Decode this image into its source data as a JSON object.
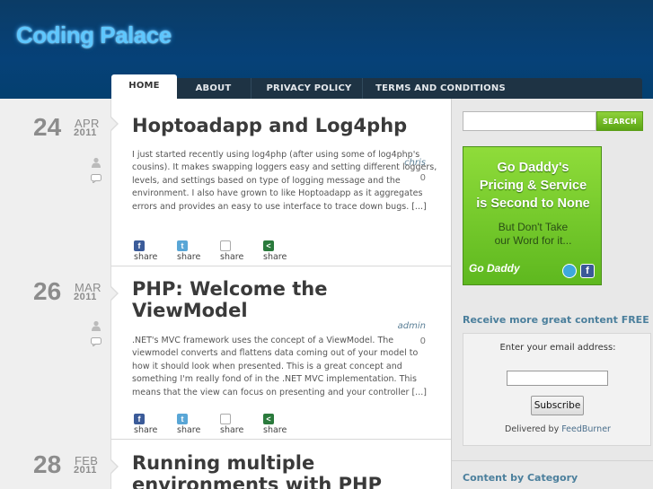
{
  "site": {
    "title": "Coding Palace"
  },
  "nav": {
    "items": [
      "HOME",
      "ABOUT",
      "PRIVACY POLICY",
      "TERMS AND CONDITIONS"
    ],
    "active": "HOME"
  },
  "posts": [
    {
      "day": "24",
      "month": "APR",
      "year": "2011",
      "author": "chris",
      "comments": "0",
      "title": "Hoptoadapp and Log4php",
      "excerpt": "I just started recently using log4php (after using some of log4php's cousins). It makes swapping loggers easy and setting different loggers, levels, and settings based on type of logging message and the environment. I also have grown to like Hoptoadapp as it aggregates errors and provides an easy to use interface to trace down bugs. [...]",
      "share_labels": [
        "share",
        "share",
        "share",
        "share"
      ]
    },
    {
      "day": "26",
      "month": "MAR",
      "year": "2011",
      "author": "admin",
      "comments": "0",
      "title": "PHP: Welcome the ViewModel",
      "excerpt": ".NET's MVC framework uses the concept of a ViewModel. The viewmodel converts and flattens data coming out of your model to how it should look when presented. This is a great concept and something I'm really fond of in the .NET MVC implementation. This means that the view can focus on presenting and your controller [...]",
      "share_labels": [
        "share",
        "share",
        "share",
        "share"
      ]
    },
    {
      "day": "28",
      "month": "FEB",
      "year": "2011",
      "title": "Running multiple environments with PHP"
    }
  ],
  "sidebar": {
    "search_button": "SEARCH",
    "ad": {
      "line1": "Go Daddy's",
      "line2": "Pricing & Service",
      "line3": "is Second to None",
      "line4": "But Don't Take",
      "line5": "our Word for it...",
      "brand": "Go Daddy",
      "fb_glyph": "f"
    },
    "feedburner": {
      "heading": "Receive more great content FREE",
      "label": "Enter your email address:",
      "subscribe": "Subscribe",
      "delivered": "Delivered by",
      "delivered_link": "FeedBurner"
    },
    "category_heading": "Content by Category"
  },
  "colors": {
    "header": "#0b3c66",
    "nav": "#1e3344",
    "accent": "#4b7f9c",
    "search": "#6fbe22"
  },
  "icons": {
    "share": [
      "facebook-icon",
      "twitter-icon",
      "email-icon",
      "share-icon"
    ],
    "meta": [
      "user-icon",
      "comment-bubble-icon"
    ]
  }
}
